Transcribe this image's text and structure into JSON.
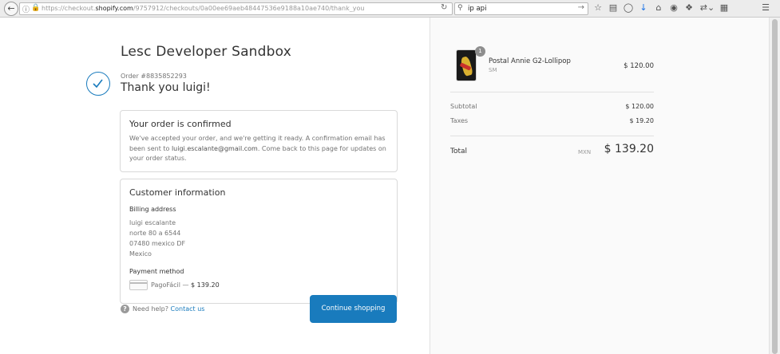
{
  "browser": {
    "url_prefix": "https://checkout.",
    "url_host": "shopify.com",
    "url_path": "/9757912/checkouts/0a00ee69aeb48447536e9188a10ae740/thank_you",
    "search_value": "ip api"
  },
  "checkout": {
    "shop_name": "Lesc Developer Sandbox",
    "order_number": "Order #8835852293",
    "thank_you": "Thank you luigi!",
    "confirmed": {
      "title": "Your order is confirmed",
      "body_1": "We've accepted your order, and we're getting it ready. A confirmation email has been sent to ",
      "email": "luigi.escalante@gmail.com",
      "body_2": ". Come back to this page for updates on your order status."
    },
    "customer": {
      "title": "Customer information",
      "billing_label": "Billing address",
      "address_lines": [
        "luigi escalante",
        "norte 80 a 6544",
        "07480 mexico DF",
        "Mexico"
      ],
      "payment_label": "Payment method",
      "payment_method": "PagoFácil",
      "payment_sep": " — ",
      "payment_amount": "$ 139.20"
    },
    "help_text": "Need help?",
    "help_link": "Contact us",
    "continue_button": "Continue shopping"
  },
  "summary": {
    "item": {
      "quantity": "1",
      "name": "Postal Annie G2-Lollipop",
      "variant": "SM",
      "price": "$ 120.00"
    },
    "subtotal_label": "Subtotal",
    "subtotal_value": "$ 120.00",
    "taxes_label": "Taxes",
    "taxes_value": "$ 19.20",
    "total_label": "Total",
    "total_currency": "MXN",
    "total_value": "$ 139.20"
  },
  "colors": {
    "accent": "#197bbd",
    "sidebar_bg": "#fafafa"
  }
}
